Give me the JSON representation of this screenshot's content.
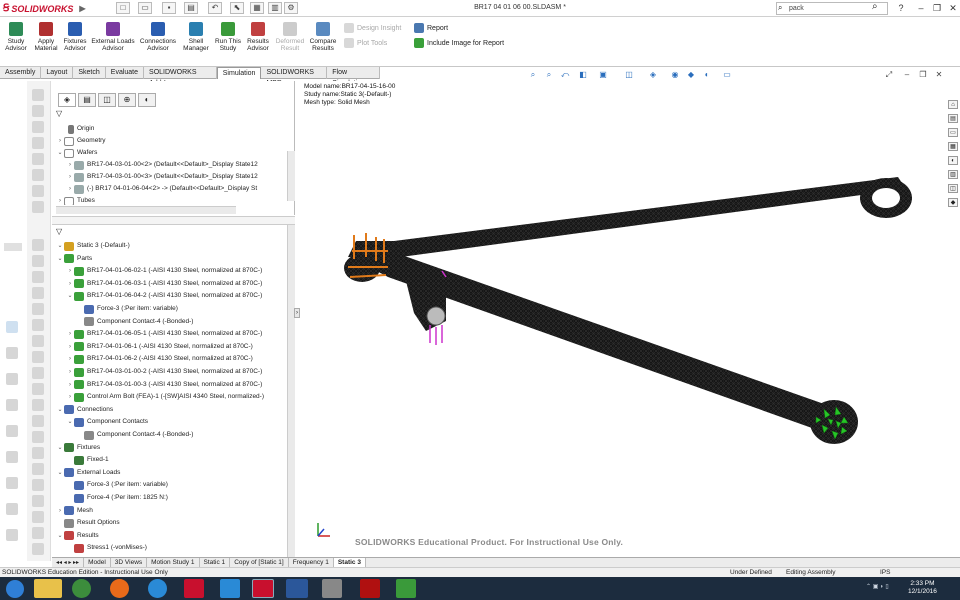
{
  "app": {
    "name": "SOLIDWORKS",
    "document_title": "BR17 04 01 06 00.SLDASM *"
  },
  "search": {
    "value": "pack"
  },
  "ribbon": {
    "buttons": [
      {
        "label": "Study Advisor",
        "color": "#2e8b57"
      },
      {
        "label": "Apply Material",
        "color": "#b03030"
      },
      {
        "label": "Fixtures Advisor",
        "color": "#2a5db0"
      },
      {
        "label": "External Loads Advisor",
        "color": "#7a3aa0"
      },
      {
        "label": "Connections Advisor",
        "color": "#2a5db0"
      },
      {
        "label": "Shell Manager",
        "color": "#2a7fb0"
      },
      {
        "label": "Run This Study",
        "color": "#3a9a3a"
      },
      {
        "label": "Results Advisor",
        "color": "#c04040"
      },
      {
        "label": "Deformed Result",
        "color": "#bbbbbb"
      },
      {
        "label": "Compare Results",
        "color": "#5a8ac0"
      }
    ],
    "small": [
      {
        "label": "Design Insight"
      },
      {
        "label": "Plot Tools"
      },
      {
        "label": "Report"
      },
      {
        "label": "Include Image for Report"
      }
    ]
  },
  "cmd_tabs": [
    "Assembly",
    "Layout",
    "Sketch",
    "Evaluate",
    "SOLIDWORKS Add-Ins",
    "Simulation",
    "SOLIDWORKS MBD",
    "Flow Simulation"
  ],
  "cmd_tab_active": "Simulation",
  "feature_tree": [
    {
      "label": "Origin",
      "level": 1
    },
    {
      "label": "Geometry",
      "level": 0
    },
    {
      "label": "Wafers",
      "level": 0
    },
    {
      "label": "BR17-04-03-01-00<2> (Default<<Default>_Display State12",
      "level": 1
    },
    {
      "label": "BR17-04-03-01-00<3> (Default<<Default>_Display State12",
      "level": 1
    },
    {
      "label": "(-) BR17 04-01-06-04<2> -> (Default<<Default>_Display St",
      "level": 1
    },
    {
      "label": "Tubes",
      "level": 0
    }
  ],
  "study_tree": [
    {
      "label": "Static 3 (-Default-)",
      "level": 0,
      "color": "#d4a020"
    },
    {
      "label": "Parts",
      "level": 0,
      "color": "#3aa03a"
    },
    {
      "label": "BR17-04-01-06-02-1 (-AISI 4130 Steel, normalized at 870C-)",
      "level": 1,
      "color": "#3aa03a"
    },
    {
      "label": "BR17-04-01-06-03-1 (-AISI 4130 Steel, normalized at 870C-)",
      "level": 1,
      "color": "#3aa03a"
    },
    {
      "label": "BR17-04-01-06-04-2 (-AISI 4130 Steel, normalized at 870C-)",
      "level": 1,
      "color": "#3aa03a"
    },
    {
      "label": "Force-3 (:Per item: variable)",
      "level": 2,
      "color": "#4a6ab0"
    },
    {
      "label": "Component Contact-4 (-Bonded-)",
      "level": 2,
      "color": "#888888"
    },
    {
      "label": "BR17-04-01-06-05-1 (-AISI 4130 Steel, normalized at 870C-)",
      "level": 1,
      "color": "#3aa03a"
    },
    {
      "label": "BR17-04-01-06-1 (-AISI 4130 Steel, normalized at 870C-)",
      "level": 1,
      "color": "#3aa03a"
    },
    {
      "label": "BR17-04-01-06-2 (-AISI 4130 Steel, normalized at 870C-)",
      "level": 1,
      "color": "#3aa03a"
    },
    {
      "label": "BR17-04-03-01-00-2 (-AISI 4130 Steel, normalized at 870C-)",
      "level": 1,
      "color": "#3aa03a"
    },
    {
      "label": "BR17-04-03-01-00-3 (-AISI 4130 Steel, normalized at 870C-)",
      "level": 1,
      "color": "#3aa03a"
    },
    {
      "label": "Control Arm Bolt (FEA)-1 (-[SW]AISI 4340 Steel, normalized-)",
      "level": 1,
      "color": "#3aa03a"
    },
    {
      "label": "Connections",
      "level": 0,
      "color": "#4a6ab0"
    },
    {
      "label": "Component Contacts",
      "level": 1,
      "color": "#4a6ab0"
    },
    {
      "label": "Component Contact-4 (-Bonded-)",
      "level": 2,
      "color": "#888888"
    },
    {
      "label": "Fixtures",
      "level": 0,
      "color": "#3a7a3a"
    },
    {
      "label": "Fixed-1",
      "level": 1,
      "color": "#3a7a3a"
    },
    {
      "label": "External Loads",
      "level": 0,
      "color": "#4a6ab0"
    },
    {
      "label": "Force-3 (:Per item: variable)",
      "level": 1,
      "color": "#4a6ab0"
    },
    {
      "label": "Force-4 (:Per item: 1825 N:)",
      "level": 1,
      "color": "#4a6ab0"
    },
    {
      "label": "Mesh",
      "level": 0,
      "color": "#4a6ab0"
    },
    {
      "label": "Result Options",
      "level": 0,
      "color": "#888888"
    },
    {
      "label": "Results",
      "level": 0,
      "color": "#c04040"
    },
    {
      "label": "Stress1 (-vonMises-)",
      "level": 1,
      "color": "#c04040"
    }
  ],
  "model_info": [
    "Model name:BR17-04-15-16-00",
    "Study name:Static 3(-Default-)",
    "Mesh type: Solid Mesh"
  ],
  "watermark": "SOLIDWORKS Educational Product. For Instructional Use Only.",
  "bottom_tabs": [
    "Model",
    "3D Views",
    "Motion Study 1",
    "Static 1",
    "Copy of [Static 1]",
    "Frequency 1",
    "Static 3"
  ],
  "bottom_tab_active": "Static 3",
  "status": {
    "left": "SOLIDWORKS Education Edition - Instructional Use Only",
    "defined": "Under Defined",
    "mode": "Editing Assembly",
    "units": "IPS"
  },
  "clock": {
    "time": "2:33 PM",
    "date": "12/1/2016"
  },
  "colors": {
    "mesh": "#1a1a1a",
    "fixture": "#27c427",
    "load": "#e07a1a",
    "force_arrow": "#cc33cc"
  }
}
